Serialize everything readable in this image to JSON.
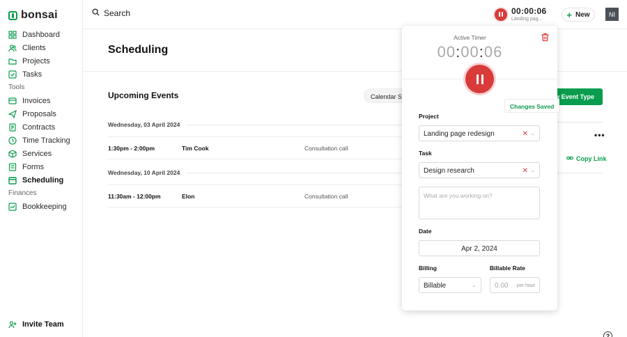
{
  "app": {
    "logo_text": "bonsai",
    "accent": "#0a9d4d",
    "danger": "#d93a3a"
  },
  "sidebar": {
    "items": [
      {
        "label": "Dashboard",
        "icon": "grid-icon"
      },
      {
        "label": "Clients",
        "icon": "users-icon"
      },
      {
        "label": "Projects",
        "icon": "folder-icon"
      },
      {
        "label": "Tasks",
        "icon": "checkbox-icon"
      }
    ],
    "tools_label": "Tools",
    "tools": [
      {
        "label": "Invoices",
        "icon": "invoice-icon"
      },
      {
        "label": "Proposals",
        "icon": "send-icon"
      },
      {
        "label": "Contracts",
        "icon": "document-icon"
      },
      {
        "label": "Time Tracking",
        "icon": "clock-icon"
      },
      {
        "label": "Services",
        "icon": "box-icon"
      },
      {
        "label": "Forms",
        "icon": "form-icon"
      },
      {
        "label": "Scheduling",
        "icon": "calendar-icon",
        "active": true
      }
    ],
    "finances_label": "Finances",
    "finances": [
      {
        "label": "Bookkeeping",
        "icon": "ledger-icon"
      }
    ],
    "invite_label": "Invite Team"
  },
  "header": {
    "search_label": "Search",
    "timer_time": "00:00:06",
    "timer_task": "Landing pag...",
    "new_label": "New",
    "avatar_initials": "NI"
  },
  "main": {
    "page_title": "Scheduling",
    "section_title": "Upcoming Events",
    "calendar_settings_label": "Calendar Se",
    "new_event_type_label": "New Event Type",
    "copy_link_label": "Copy Link",
    "more_label": "•••",
    "days": [
      {
        "date": "Wednesday, 03 April 2024",
        "events": [
          {
            "time": "1:30pm - 2:00pm",
            "name": "Tim Cook",
            "type": "Consultation call"
          }
        ]
      },
      {
        "date": "Wednesday, 10 April 2024",
        "events": [
          {
            "time": "11:30am - 12:00pm",
            "name": "Elon",
            "type": "Consultation call"
          }
        ]
      }
    ]
  },
  "timer_popup": {
    "active_label": "Active Timer",
    "hours": "00",
    "minutes": "00",
    "seconds": "06",
    "changes_saved": "Changes Saved",
    "project_label": "Project",
    "project_value": "Landing page redesign",
    "task_label": "Task",
    "task_value": "Design research",
    "notes_placeholder": "What are you working on?",
    "date_label": "Date",
    "date_value": "Apr 2, 2024",
    "billing_label": "Billing",
    "billing_value": "Billable",
    "rate_label": "Billable Rate",
    "rate_placeholder": "0.00",
    "rate_unit": "per hour"
  }
}
